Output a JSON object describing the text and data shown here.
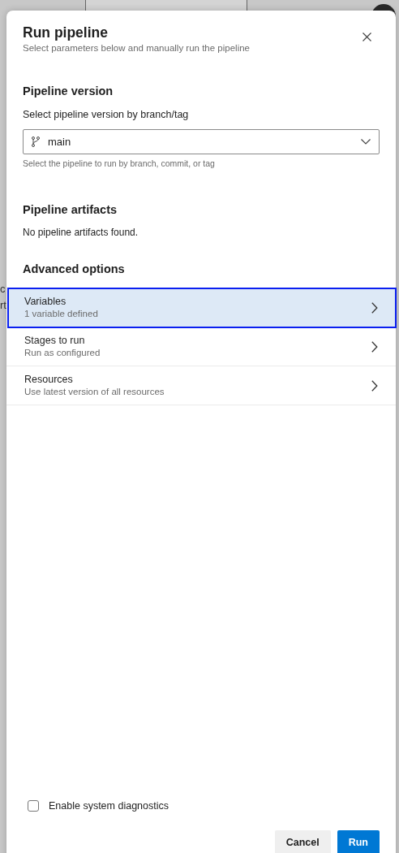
{
  "background": {
    "fragments": [
      "c",
      "rt"
    ]
  },
  "dialog": {
    "title": "Run pipeline",
    "subtitle": "Select parameters below and manually run the pipeline"
  },
  "pipeline_version": {
    "heading": "Pipeline version",
    "label": "Select pipeline version by branch/tag",
    "value": "main",
    "help": "Select the pipeline to run by branch, commit, or tag"
  },
  "pipeline_artifacts": {
    "heading": "Pipeline artifacts",
    "message": "No pipeline artifacts found."
  },
  "advanced_options": {
    "heading": "Advanced options",
    "items": [
      {
        "title": "Variables",
        "subtitle": "1 variable defined",
        "selected": true
      },
      {
        "title": "Stages to run",
        "subtitle": "Run as configured",
        "selected": false
      },
      {
        "title": "Resources",
        "subtitle": "Use latest version of all resources",
        "selected": false
      }
    ]
  },
  "diagnostics": {
    "label": "Enable system diagnostics",
    "checked": false
  },
  "buttons": [
    {
      "label": "Cancel",
      "kind": "secondary"
    },
    {
      "label": "Run",
      "kind": "primary"
    }
  ]
}
